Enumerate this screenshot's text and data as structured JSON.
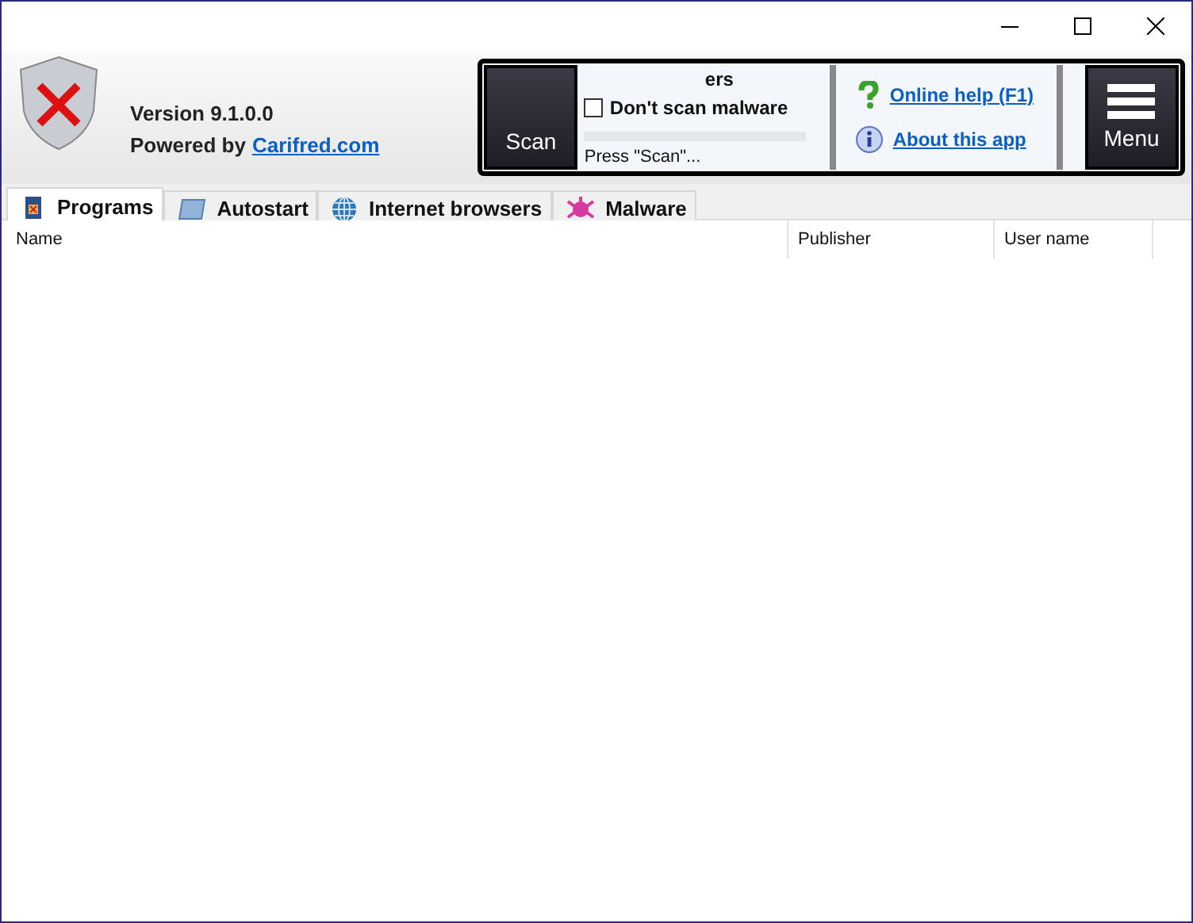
{
  "header": {
    "version": "Version 9.1.0.0",
    "powered_by": "Powered by",
    "powered_link": "Carifred.com"
  },
  "scan_panel": {
    "scan_button": "Scan",
    "options": [
      {
        "label": "ers",
        "kind": "partial"
      },
      {
        "label": "Don't scan malware",
        "kind": "checkbox",
        "checked": false
      }
    ],
    "progress": {
      "level": 0
    },
    "status": "Press \"Scan\"..."
  },
  "links": [
    {
      "label": "Online help (F1)"
    },
    {
      "label": "About this app"
    }
  ],
  "menu_button": "Menu",
  "tabs": [
    {
      "label": "Programs",
      "selected": true
    },
    {
      "label": "Autostart",
      "selected": false
    },
    {
      "label": "Internet browsers",
      "selected": false
    },
    {
      "label": "Malware",
      "selected": false
    }
  ],
  "table": {
    "columns": [
      "Name",
      "Publisher",
      "User name"
    ]
  }
}
